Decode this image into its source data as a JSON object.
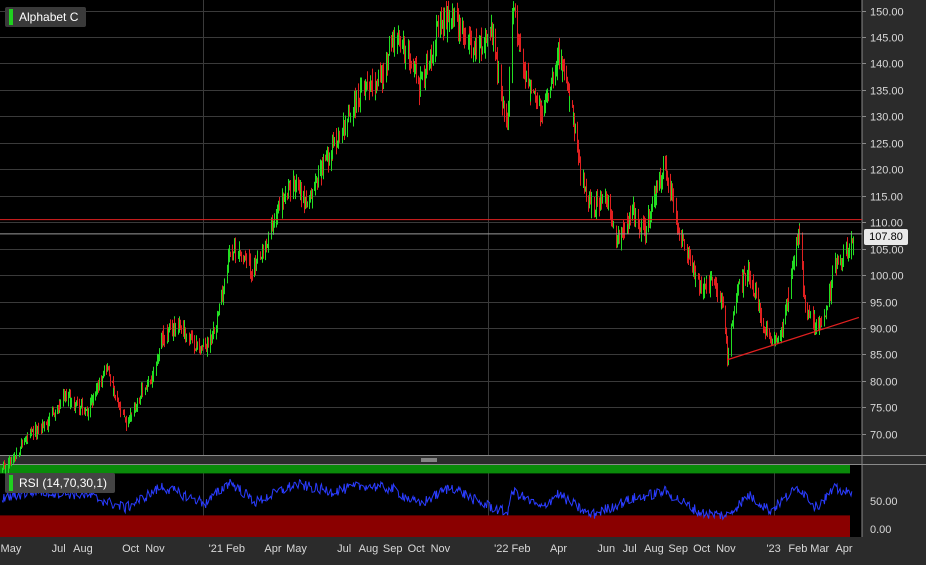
{
  "chart_data": [
    {
      "type": "candlestick",
      "title": "Alphabet C",
      "last_price": "107.80",
      "horizontal_line": 110.5,
      "trendline": {
        "from": {
          "x": "2022-11-03",
          "y": 84
        },
        "to": {
          "x": "2023-04-20",
          "y": 92
        }
      },
      "ylim": [
        66,
        152
      ],
      "y_ticks": [
        150,
        145,
        140,
        135,
        130,
        125,
        120,
        115,
        110,
        105,
        100,
        95,
        90,
        85,
        80,
        75,
        70
      ],
      "y_tick_labels": [
        "150.00",
        "145.00",
        "140.00",
        "135.00",
        "130.00",
        "125.00",
        "120.00",
        "115.00",
        "110.00",
        "105.00",
        "100.00",
        "95.00",
        "90.00",
        "85.00",
        "80.00",
        "75.00",
        "70.00"
      ],
      "x_tick_labels": [
        "May",
        "Jul",
        "Aug",
        "Oct",
        "Nov",
        "'21 Feb",
        "Apr",
        "May",
        "Jul",
        "Aug",
        "Sep",
        "Oct",
        "Nov",
        "'22 Feb",
        "Apr",
        "Jun",
        "Jul",
        "Aug",
        "Sep",
        "Oct",
        "Nov",
        "'23",
        "Feb",
        "Mar",
        "Apr"
      ],
      "x_tick_dates": [
        "2020-05-01",
        "2020-07-01",
        "2020-08-01",
        "2020-10-01",
        "2020-11-01",
        "2021-02-01",
        "2021-04-01",
        "2021-05-01",
        "2021-07-01",
        "2021-08-01",
        "2021-09-01",
        "2021-10-01",
        "2021-11-01",
        "2022-02-01",
        "2022-04-01",
        "2022-06-01",
        "2022-07-01",
        "2022-08-01",
        "2022-09-01",
        "2022-10-01",
        "2022-11-01",
        "2023-01-01",
        "2023-02-01",
        "2023-03-01",
        "2023-04-01"
      ],
      "gridlines_x_dates": [
        "2021-01-01",
        "2022-01-01",
        "2023-01-01"
      ],
      "price_path": [
        {
          "x": "2020-04-20",
          "y": 63
        },
        {
          "x": "2020-05-20",
          "y": 69
        },
        {
          "x": "2020-06-15",
          "y": 72
        },
        {
          "x": "2020-07-10",
          "y": 77
        },
        {
          "x": "2020-08-05",
          "y": 74
        },
        {
          "x": "2020-08-31",
          "y": 83
        },
        {
          "x": "2020-09-10",
          "y": 77
        },
        {
          "x": "2020-09-25",
          "y": 72
        },
        {
          "x": "2020-10-15",
          "y": 78
        },
        {
          "x": "2020-10-28",
          "y": 80
        },
        {
          "x": "2020-11-10",
          "y": 88
        },
        {
          "x": "2020-12-01",
          "y": 91
        },
        {
          "x": "2020-12-20",
          "y": 87
        },
        {
          "x": "2021-01-05",
          "y": 86
        },
        {
          "x": "2021-01-20",
          "y": 92
        },
        {
          "x": "2021-02-05",
          "y": 105
        },
        {
          "x": "2021-02-20",
          "y": 104
        },
        {
          "x": "2021-03-05",
          "y": 101
        },
        {
          "x": "2021-03-20",
          "y": 104
        },
        {
          "x": "2021-04-05",
          "y": 112
        },
        {
          "x": "2021-04-30",
          "y": 118
        },
        {
          "x": "2021-05-15",
          "y": 113
        },
        {
          "x": "2021-05-31",
          "y": 120
        },
        {
          "x": "2021-06-15",
          "y": 124
        },
        {
          "x": "2021-07-10",
          "y": 131
        },
        {
          "x": "2021-07-28",
          "y": 136
        },
        {
          "x": "2021-08-20",
          "y": 138
        },
        {
          "x": "2021-09-01",
          "y": 145
        },
        {
          "x": "2021-09-25",
          "y": 141
        },
        {
          "x": "2021-10-05",
          "y": 136
        },
        {
          "x": "2021-10-28",
          "y": 146
        },
        {
          "x": "2021-11-15",
          "y": 150
        },
        {
          "x": "2021-11-30",
          "y": 145
        },
        {
          "x": "2021-12-20",
          "y": 143
        },
        {
          "x": "2022-01-05",
          "y": 146
        },
        {
          "x": "2022-01-25",
          "y": 128
        },
        {
          "x": "2022-02-02",
          "y": 150
        },
        {
          "x": "2022-02-20",
          "y": 136
        },
        {
          "x": "2022-03-10",
          "y": 130
        },
        {
          "x": "2022-03-31",
          "y": 142
        },
        {
          "x": "2022-04-15",
          "y": 133
        },
        {
          "x": "2022-04-30",
          "y": 118
        },
        {
          "x": "2022-05-12",
          "y": 113
        },
        {
          "x": "2022-05-31",
          "y": 114
        },
        {
          "x": "2022-06-15",
          "y": 107
        },
        {
          "x": "2022-07-05",
          "y": 112
        },
        {
          "x": "2022-07-20",
          "y": 108
        },
        {
          "x": "2022-08-15",
          "y": 121
        },
        {
          "x": "2022-08-31",
          "y": 110
        },
        {
          "x": "2022-09-15",
          "y": 103
        },
        {
          "x": "2022-09-30",
          "y": 97
        },
        {
          "x": "2022-10-15",
          "y": 99
        },
        {
          "x": "2022-10-28",
          "y": 94
        },
        {
          "x": "2022-11-03",
          "y": 85
        },
        {
          "x": "2022-11-15",
          "y": 97
        },
        {
          "x": "2022-11-30",
          "y": 101
        },
        {
          "x": "2022-12-15",
          "y": 92
        },
        {
          "x": "2022-12-28",
          "y": 87
        },
        {
          "x": "2023-01-12",
          "y": 90
        },
        {
          "x": "2023-02-02",
          "y": 108
        },
        {
          "x": "2023-02-10",
          "y": 95
        },
        {
          "x": "2023-02-24",
          "y": 90
        },
        {
          "x": "2023-03-08",
          "y": 92
        },
        {
          "x": "2023-03-20",
          "y": 102
        },
        {
          "x": "2023-04-05",
          "y": 105
        },
        {
          "x": "2023-04-20",
          "y": 107.8
        }
      ]
    },
    {
      "type": "line",
      "title": "RSI (14,70,30,1)",
      "overbought": 70,
      "oversold": 30,
      "ylim": [
        20,
        80
      ],
      "y_ticks": [
        50,
        0
      ],
      "y_tick_labels": [
        "50.00",
        "0.00"
      ],
      "rsi_path": [
        {
          "x": "2020-04-20",
          "y": 52
        },
        {
          "x": "2020-06-01",
          "y": 58
        },
        {
          "x": "2020-08-05",
          "y": 55
        },
        {
          "x": "2020-09-25",
          "y": 44
        },
        {
          "x": "2020-11-10",
          "y": 62
        },
        {
          "x": "2021-01-05",
          "y": 48
        },
        {
          "x": "2021-02-05",
          "y": 66
        },
        {
          "x": "2021-03-10",
          "y": 49
        },
        {
          "x": "2021-04-30",
          "y": 64
        },
        {
          "x": "2021-06-15",
          "y": 58
        },
        {
          "x": "2021-07-28",
          "y": 63
        },
        {
          "x": "2021-09-01",
          "y": 60
        },
        {
          "x": "2021-10-05",
          "y": 47
        },
        {
          "x": "2021-11-15",
          "y": 62
        },
        {
          "x": "2021-12-20",
          "y": 49
        },
        {
          "x": "2022-01-25",
          "y": 40
        },
        {
          "x": "2022-02-02",
          "y": 58
        },
        {
          "x": "2022-03-10",
          "y": 44
        },
        {
          "x": "2022-03-31",
          "y": 56
        },
        {
          "x": "2022-05-12",
          "y": 38
        },
        {
          "x": "2022-07-05",
          "y": 52
        },
        {
          "x": "2022-08-15",
          "y": 58
        },
        {
          "x": "2022-09-30",
          "y": 40
        },
        {
          "x": "2022-11-03",
          "y": 38
        },
        {
          "x": "2022-11-30",
          "y": 55
        },
        {
          "x": "2022-12-28",
          "y": 42
        },
        {
          "x": "2023-02-02",
          "y": 62
        },
        {
          "x": "2023-02-24",
          "y": 45
        },
        {
          "x": "2023-03-20",
          "y": 60
        },
        {
          "x": "2023-04-20",
          "y": 54
        }
      ]
    }
  ]
}
